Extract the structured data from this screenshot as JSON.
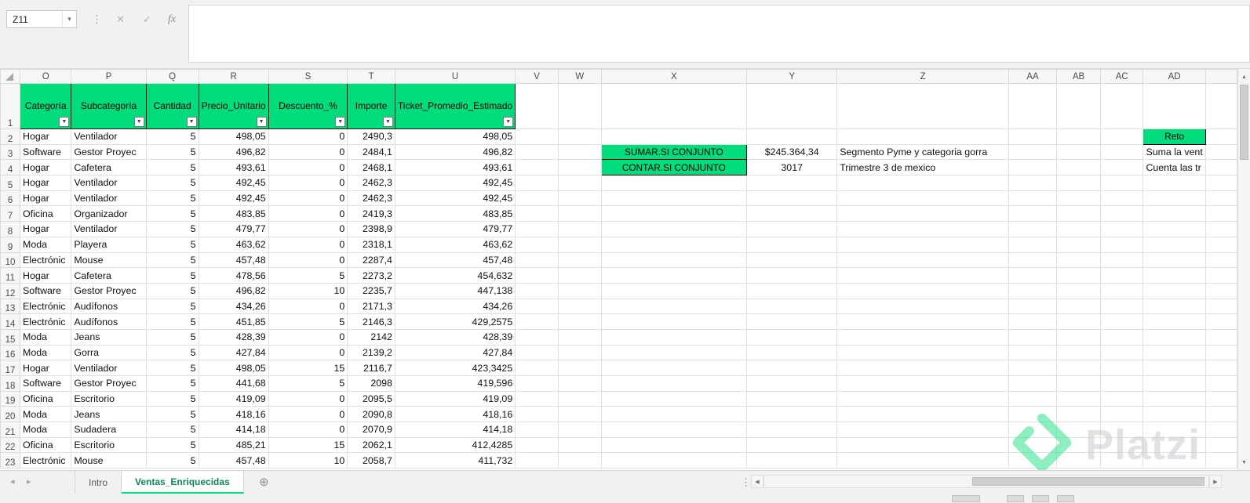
{
  "chrome": {
    "name_box": "Z11",
    "formula_value": ""
  },
  "icons": {
    "name_box_dropdown": "▾",
    "more_vertical": "⋮",
    "cancel": "✕",
    "confirm": "✓",
    "insert_function": "fx",
    "filter_arrow": "▼",
    "tab_nav_left": "◂",
    "tab_nav_right": "▸",
    "add_sheet": "⊕",
    "scroll_up": "▲",
    "scroll_down": "▼",
    "scroll_left": "◀",
    "scroll_right": "▶"
  },
  "colors": {
    "header_green": "#03DC7C",
    "tab_text_green": "#0A8A4F",
    "accent_green": "#05DD7D",
    "watermark_green": "#31E38B"
  },
  "grid": {
    "header_row_number": "1",
    "column_letters": [
      "O",
      "P",
      "Q",
      "R",
      "S",
      "T",
      "U",
      "V",
      "W",
      "X",
      "Y",
      "Z",
      "AA",
      "AB",
      "AC",
      "AD",
      ""
    ],
    "headers": [
      "Categoría",
      "Subcategoría",
      "Cantidad",
      "Precio_Unitario",
      "Descuento_%",
      "Importe",
      "Ticket_Promedio_Estimado"
    ],
    "rows": [
      {
        "n": "2",
        "c": [
          "Hogar",
          "Ventilador",
          "5",
          "498,05",
          "0",
          "2490,3",
          "498,05"
        ]
      },
      {
        "n": "3",
        "c": [
          "Software",
          "Gestor Proyec",
          "5",
          "496,82",
          "0",
          "2484,1",
          "496,82"
        ]
      },
      {
        "n": "4",
        "c": [
          "Hogar",
          "Cafetera",
          "5",
          "493,61",
          "0",
          "2468,1",
          "493,61"
        ]
      },
      {
        "n": "5",
        "c": [
          "Hogar",
          "Ventilador",
          "5",
          "492,45",
          "0",
          "2462,3",
          "492,45"
        ]
      },
      {
        "n": "6",
        "c": [
          "Hogar",
          "Ventilador",
          "5",
          "492,45",
          "0",
          "2462,3",
          "492,45"
        ]
      },
      {
        "n": "7",
        "c": [
          "Oficina",
          "Organizador",
          "5",
          "483,85",
          "0",
          "2419,3",
          "483,85"
        ]
      },
      {
        "n": "8",
        "c": [
          "Hogar",
          "Ventilador",
          "5",
          "479,77",
          "0",
          "2398,9",
          "479,77"
        ]
      },
      {
        "n": "9",
        "c": [
          "Moda",
          "Playera",
          "5",
          "463,62",
          "0",
          "2318,1",
          "463,62"
        ]
      },
      {
        "n": "10",
        "c": [
          "Electrónic",
          "Mouse",
          "5",
          "457,48",
          "0",
          "2287,4",
          "457,48"
        ]
      },
      {
        "n": "11",
        "c": [
          "Hogar",
          "Cafetera",
          "5",
          "478,56",
          "5",
          "2273,2",
          "454,632"
        ]
      },
      {
        "n": "12",
        "c": [
          "Software",
          "Gestor Proyec",
          "5",
          "496,82",
          "10",
          "2235,7",
          "447,138"
        ]
      },
      {
        "n": "13",
        "c": [
          "Electrónic",
          "Audífonos",
          "5",
          "434,26",
          "0",
          "2171,3",
          "434,26"
        ]
      },
      {
        "n": "14",
        "c": [
          "Electrónic",
          "Audífonos",
          "5",
          "451,85",
          "5",
          "2146,3",
          "429,2575"
        ]
      },
      {
        "n": "15",
        "c": [
          "Moda",
          "Jeans",
          "5",
          "428,39",
          "0",
          "2142",
          "428,39"
        ]
      },
      {
        "n": "16",
        "c": [
          "Moda",
          "Gorra",
          "5",
          "427,84",
          "0",
          "2139,2",
          "427,84"
        ]
      },
      {
        "n": "17",
        "c": [
          "Hogar",
          "Ventilador",
          "5",
          "498,05",
          "15",
          "2116,7",
          "423,3425"
        ]
      },
      {
        "n": "18",
        "c": [
          "Software",
          "Gestor Proyec",
          "5",
          "441,68",
          "5",
          "2098",
          "419,596"
        ]
      },
      {
        "n": "19",
        "c": [
          "Oficina",
          "Escritorio",
          "5",
          "419,09",
          "0",
          "2095,5",
          "419,09"
        ]
      },
      {
        "n": "20",
        "c": [
          "Moda",
          "Jeans",
          "5",
          "418,16",
          "0",
          "2090,8",
          "418,16"
        ]
      },
      {
        "n": "21",
        "c": [
          "Moda",
          "Sudadera",
          "5",
          "414,18",
          "0",
          "2070,9",
          "414,18"
        ]
      },
      {
        "n": "22",
        "c": [
          "Oficina",
          "Escritorio",
          "5",
          "485,21",
          "15",
          "2062,1",
          "412,4285"
        ]
      },
      {
        "n": "23",
        "c": [
          "Electrónic",
          "Mouse",
          "5",
          "457,48",
          "10",
          "2058,7",
          "411,732"
        ]
      }
    ],
    "annotations": [
      {
        "cell": "X3",
        "text": "SUMAR.SI CONJUNTO",
        "style": "green-box"
      },
      {
        "cell": "Y3",
        "text": "$245.364,34",
        "style": "center"
      },
      {
        "cell": "Z3",
        "text": "Segmento Pyme y categoria gorra",
        "style": "left"
      },
      {
        "cell": "X4",
        "text": "CONTAR.SI CONJUNTO",
        "style": "green-box"
      },
      {
        "cell": "Y4",
        "text": "3017",
        "style": "center"
      },
      {
        "cell": "Z4",
        "text": "Trimestre 3 de mexico",
        "style": "left"
      },
      {
        "cell": "AD2",
        "text": "Reto",
        "style": "green-box"
      },
      {
        "cell": "AD3",
        "text": "Suma la vent",
        "style": "left-spill"
      },
      {
        "cell": "AD4",
        "text": "Cuenta las tr",
        "style": "left-spill"
      }
    ]
  },
  "sheet_tabs": {
    "items": [
      {
        "label": "Intro",
        "active": false
      },
      {
        "label": "Ventas_Enriquecidas",
        "active": true
      }
    ]
  },
  "watermark": {
    "text": "Platzi"
  }
}
